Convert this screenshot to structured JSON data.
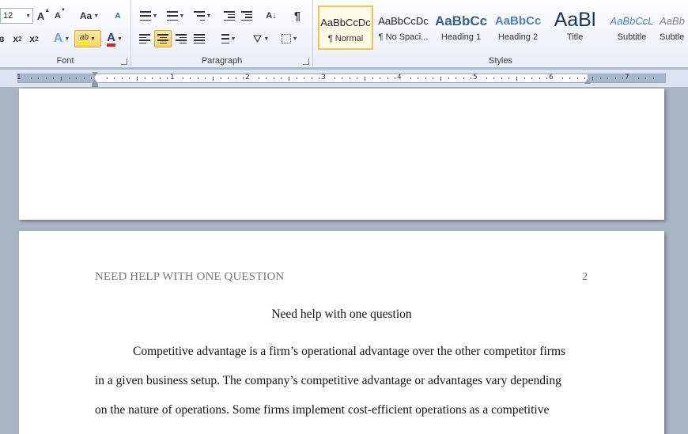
{
  "ribbon": {
    "font_group": {
      "label": "Font",
      "font_size": "12",
      "grow_font": "A",
      "shrink_font": "A",
      "change_case": "Aa",
      "clear_format": "A",
      "subscript": "x",
      "subscript_sub": "2",
      "superscript": "x",
      "superscript_sup": "2",
      "text_effects": "A",
      "highlight": "ab",
      "font_color": "A",
      "font_color_value": "#e0201c",
      "highlight_color_value": "#fff200"
    },
    "paragraph_group": {
      "label": "Paragraph",
      "sort": "A↓",
      "pilcrow": "¶"
    },
    "styles_group": {
      "label": "Styles",
      "styles": [
        {
          "sample": "AaBbCcDc",
          "name": "¶ Normal",
          "selected": true
        },
        {
          "sample": "AaBbCcDc",
          "name": "¶ No Spaci...",
          "selected": false
        },
        {
          "sample": "AaBbCc",
          "name": "Heading 1",
          "selected": false
        },
        {
          "sample": "AaBbCc",
          "name": "Heading 2",
          "selected": false
        },
        {
          "sample": "AaBl",
          "name": "Title",
          "selected": false
        },
        {
          "sample": "AaBbCcL",
          "name": "Subtitle",
          "selected": false
        },
        {
          "sample": "AaBb",
          "name": "Subtle",
          "selected": false
        }
      ]
    }
  },
  "ruler": {
    "numbers": [
      "1",
      "1",
      "2",
      "3",
      "4",
      "5",
      "6",
      "7"
    ]
  },
  "document": {
    "header_text": "NEED HELP WITH ONE QUESTION",
    "page_number": "2",
    "title": "Need help with one question",
    "lines": [
      "Competitive advantage is a firm’s operational advantage over the other competitor firms",
      "in a given business setup. The company’s competitive advantage or advantages vary depending",
      "on the nature of operations. Some firms implement cost-efficient operations as a competitive"
    ]
  }
}
